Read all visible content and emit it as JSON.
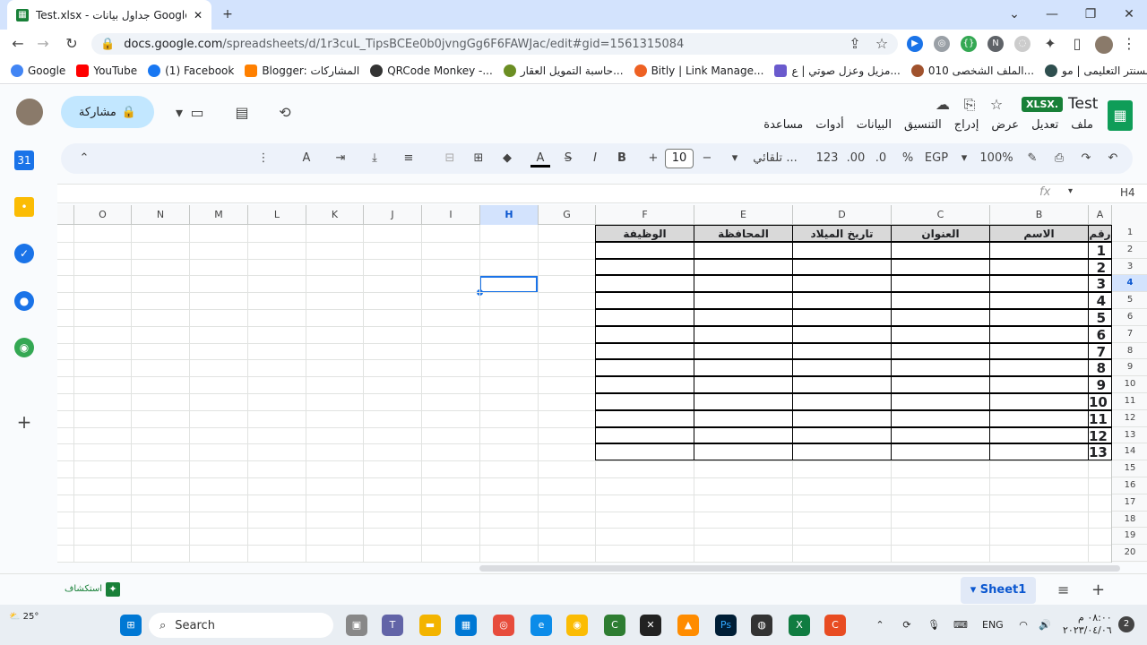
{
  "browser": {
    "tab_title": "Test.xlsx - جداول بيانات Google",
    "url_host": "docs.google.com",
    "url_path": "/spreadsheets/d/1r3cuL_TipsBCEe0b0jvngGg6F6FAWJac/edit#gid=1561315084",
    "bookmarks": [
      "Google",
      "YouTube",
      "(1) Facebook",
      "Blogger: المشاركات",
      "QRCode Monkey -...",
      "حاسبة التمويل العقار...",
      "Bitly | Link Manage...",
      "مزيل وعزل صوتي | ع...",
      "الملف الشخصى 010...",
      "السنتر التعليمى | مو..."
    ]
  },
  "sheets": {
    "doc_title": "Test",
    "badge": "XLSX.",
    "menu": [
      "ملف",
      "تعديل",
      "عرض",
      "إدراج",
      "التنسيق",
      "البيانات",
      "أدوات",
      "مساعدة"
    ],
    "share_label": "مشاركة",
    "toolbar": {
      "zoom": "100%",
      "currency": "EGP",
      "percent": "%",
      "dec_less": ".0",
      "dec_more": ".00",
      "format_num": "123",
      "font": "تلقائي ...",
      "font_size": "10"
    },
    "cell_ref": "H4",
    "fx": "fx",
    "columns": [
      "A",
      "B",
      "C",
      "D",
      "E",
      "F",
      "G",
      "H",
      "I",
      "J",
      "K",
      "L",
      "M",
      "N",
      "O"
    ],
    "selected_column": "H",
    "rows": [
      "1",
      "2",
      "3",
      "4",
      "5",
      "6",
      "7",
      "8",
      "9",
      "10",
      "11",
      "12",
      "13",
      "14",
      "15",
      "16",
      "17",
      "18",
      "19",
      "20"
    ],
    "selected_row": "4",
    "table_headers": [
      "رقم",
      "الاسم",
      "العنوان",
      "تاريخ الميلاد",
      "المحافظة",
      "الوظيفة"
    ],
    "row_numbers": [
      "1",
      "2",
      "3",
      "4",
      "5",
      "6",
      "7",
      "8",
      "9",
      "10",
      "11",
      "12",
      "13"
    ],
    "sheet_tab": "Sheet1",
    "explore_label": "استكشاف"
  },
  "taskbar": {
    "weather": "25°",
    "search_placeholder": "Search",
    "lang": "ENG",
    "time": "٠٨:٠٠ م",
    "date": "٢٠٢٣/٠٤/٠٦",
    "notif": "2"
  }
}
